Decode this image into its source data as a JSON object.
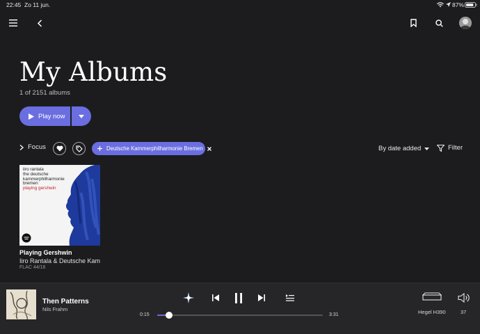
{
  "status_bar": {
    "time": "22:45",
    "date": "Zo 11 jun.",
    "battery": "87%",
    "battery_level": 0.87
  },
  "header": {
    "title": "My Albums",
    "subtitle": "1 of 2151 albums"
  },
  "actions": {
    "play_label": "Play now"
  },
  "filters": {
    "focus_label": "Focus",
    "chip_label": "Deutsche Kammerphilharmonie Bremen",
    "sort_label": "By date added",
    "filter_label": "Filter"
  },
  "albums": [
    {
      "title": "Playing Gershwin",
      "artist": "Iiro Rantala & Deutsche Kammerphilharmonie Bremen",
      "format": "FLAC 44/16",
      "cover_lines": [
        "iiro rantala",
        "the deutsche",
        "kammerphilharmonie",
        "bremen"
      ],
      "cover_highlight": "playing gershwin"
    }
  ],
  "now_playing": {
    "title": "Then Patterns",
    "artist": "Nils Frahm",
    "elapsed": "0:15",
    "duration": "3:31",
    "progress": 0.071,
    "device": "Hegel H390",
    "volume": "37"
  },
  "colors": {
    "background": "#1c1c1e",
    "accent": "#6a6ee0",
    "player_bar": "#262629"
  }
}
